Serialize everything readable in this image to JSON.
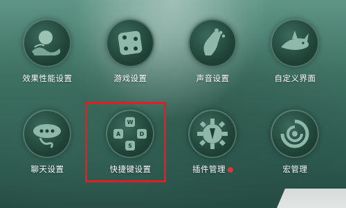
{
  "menu": {
    "items": [
      {
        "label": "效果性能设置",
        "icon": "moon-landscape-icon"
      },
      {
        "label": "游戏设置",
        "icon": "dice-icon"
      },
      {
        "label": "声音设置",
        "icon": "foot-icon"
      },
      {
        "label": "自定义界面",
        "icon": "shark-icon"
      },
      {
        "label": "聊天设置",
        "icon": "chat-cloud-icon"
      },
      {
        "label": "快捷键设置",
        "icon": "wasd-keypad-icon",
        "keys": [
          "W",
          "A",
          "D",
          "S"
        ]
      },
      {
        "label": "插件管理",
        "icon": "gear-plugin-icon",
        "badge": true
      },
      {
        "label": "宏管理",
        "icon": "swirl-icon"
      }
    ],
    "highlighted_item": "快捷键设置"
  },
  "colors": {
    "background": "#3f7263",
    "icon_circle": "#204337",
    "icon_glyph": "#8fb8aa",
    "label_text": "#ffffff",
    "highlight_border": "#e51c23",
    "badge": "#d9383a"
  }
}
